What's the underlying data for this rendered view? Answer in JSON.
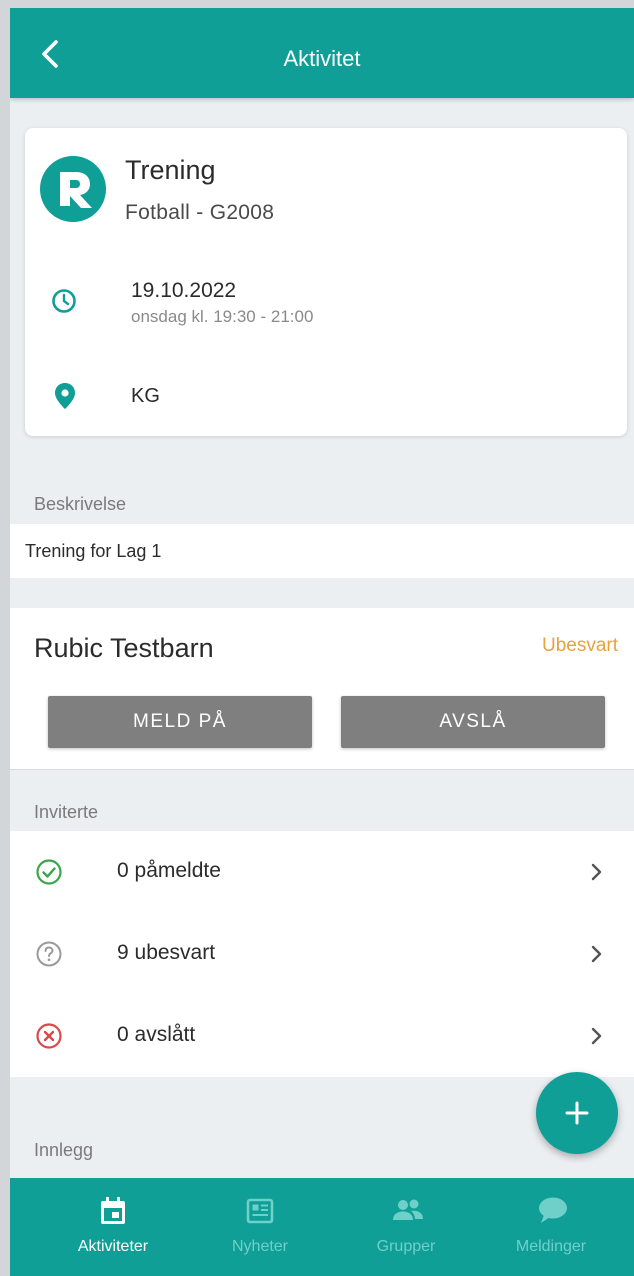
{
  "header": {
    "title": "Aktivitet"
  },
  "activity": {
    "title": "Trening",
    "subtitle": "Fotball - G2008",
    "date": "19.10.2022",
    "time": "onsdag kl. 19:30 - 21:00",
    "location": "KG"
  },
  "description": {
    "label": "Beskrivelse",
    "text": "Trening for Lag 1"
  },
  "participant": {
    "name": "Rubic Testbarn",
    "status": "Ubesvart",
    "accept_label": "MELD PÅ",
    "decline_label": "AVSLÅ"
  },
  "invited": {
    "label": "Inviterte",
    "rows": [
      {
        "label": "0 påmeldte",
        "icon": "check-circle-icon",
        "color": "#3aa54a"
      },
      {
        "label": "9 ubesvart",
        "icon": "question-circle-icon",
        "color": "#9a9a9a"
      },
      {
        "label": "0 avslått",
        "icon": "x-circle-icon",
        "color": "#d84a4a"
      }
    ]
  },
  "posts": {
    "label": "Innlegg"
  },
  "tabs": [
    {
      "label": "Aktiviteter",
      "icon": "calendar-icon",
      "active": true
    },
    {
      "label": "Nyheter",
      "icon": "newspaper-icon",
      "active": false
    },
    {
      "label": "Grupper",
      "icon": "people-icon",
      "active": false
    },
    {
      "label": "Meldinger",
      "icon": "chat-bubble-icon",
      "active": false
    }
  ],
  "colors": {
    "brand": "#0f9f97",
    "pending": "#e8a33a",
    "button": "#7f7f7f"
  }
}
